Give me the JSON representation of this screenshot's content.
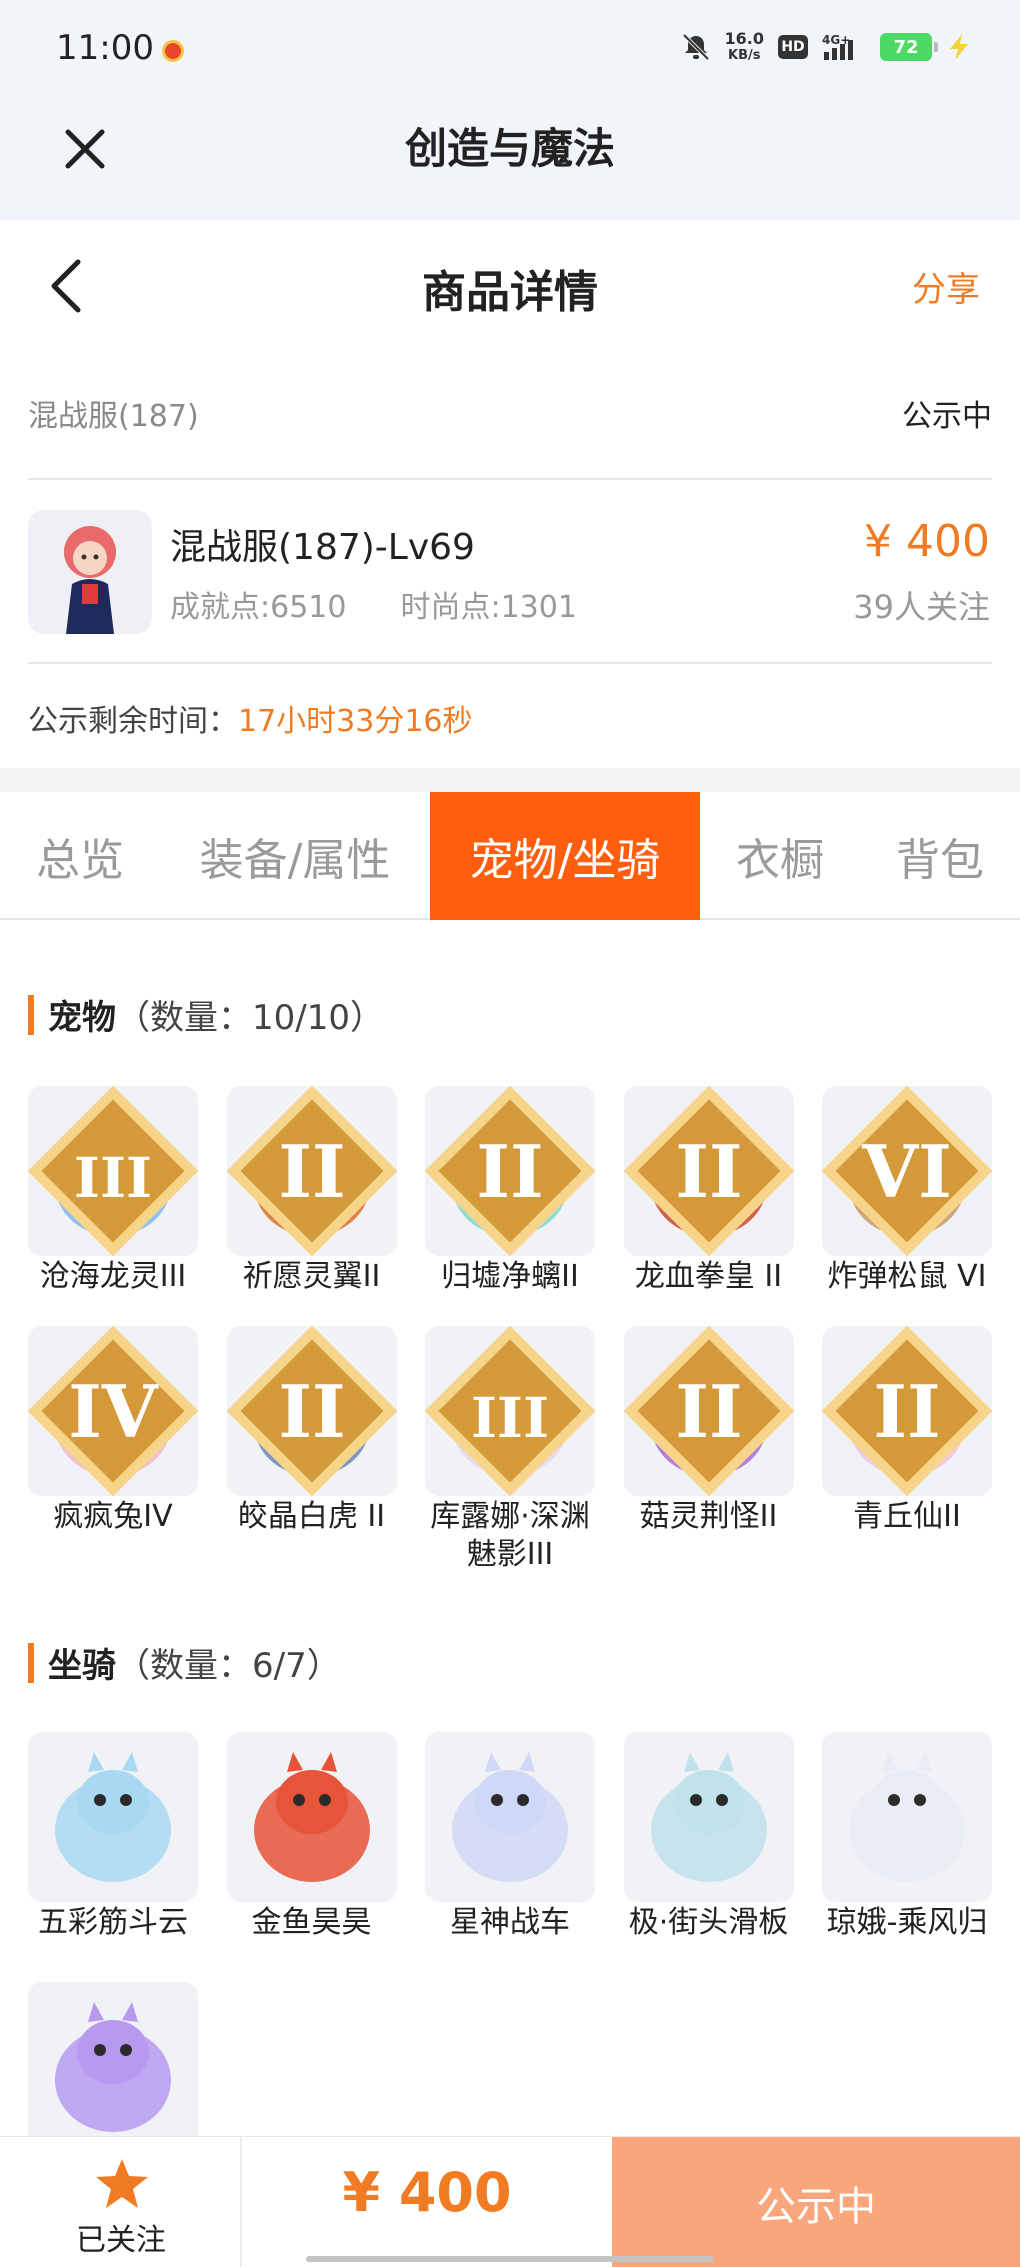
{
  "status_bar": {
    "time": "11:00",
    "net_speed_value": "16.0",
    "net_speed_unit": "KB/s",
    "hd": "HD",
    "network": "4G+",
    "battery": "72"
  },
  "app_header": {
    "title": "创造与魔法"
  },
  "page_nav": {
    "title": "商品详情",
    "share": "分享"
  },
  "listing": {
    "server": "混战服(187)",
    "status": "公示中",
    "name": "混战服(187)-Lv69",
    "achievement": "成就点:6510",
    "fashion": "时尚点:1301",
    "price": "¥ 400",
    "followers": "39人关注",
    "timer_label": "公示剩余时间：",
    "timer_value": "17小时33分16秒"
  },
  "tabs": [
    "总览",
    "装备/属性",
    "宠物/坐骑",
    "衣橱",
    "背包"
  ],
  "active_tab": 2,
  "pets": {
    "title": "宠物",
    "count": "（数量：10/10）",
    "items": [
      {
        "name": "沧海龙灵III",
        "grade": "III",
        "color": "#7fb6f0"
      },
      {
        "name": "祈愿灵翼II",
        "grade": "II",
        "color": "#d8742f"
      },
      {
        "name": "归墟净螭II",
        "grade": "II",
        "color": "#7fd6d0"
      },
      {
        "name": "龙血拳皇 II",
        "grade": "II",
        "color": "#c94a2e"
      },
      {
        "name": "炸弹松鼠 VI",
        "grade": "VI",
        "color": "#c99a66"
      },
      {
        "name": "疯疯兔IV",
        "grade": "IV",
        "color": "#f2b7c8"
      },
      {
        "name": "皎晶白虎 II",
        "grade": "II",
        "color": "#6c86b8"
      },
      {
        "name": "库露娜·深渊魅影III",
        "grade": "III",
        "color": "#e6d6f2"
      },
      {
        "name": "菇灵荆怪II",
        "grade": "II",
        "color": "#a46ad8"
      },
      {
        "name": "青丘仙II",
        "grade": "II",
        "color": "#efc3e6"
      }
    ]
  },
  "mounts": {
    "title": "坐骑",
    "count": "（数量：6/7）",
    "items": [
      {
        "name": "五彩筋斗云",
        "color": "#a9d8f2"
      },
      {
        "name": "金鱼昊昊",
        "color": "#e8543a"
      },
      {
        "name": "星神战车",
        "color": "#cfd8f6"
      },
      {
        "name": "极·街头滑板",
        "color": "#bfe2ec"
      },
      {
        "name": "琼娥-乘风归",
        "color": "#e9ecf6"
      },
      {
        "name": "",
        "color": "#b79af0"
      }
    ]
  },
  "bottom_bar": {
    "follow_label": "已关注",
    "price": "¥ 400",
    "action": "公示中"
  },
  "colors": {
    "accent": "#f07b22",
    "tab_active": "#ff5e0e",
    "action_button": "#f9a67d"
  }
}
